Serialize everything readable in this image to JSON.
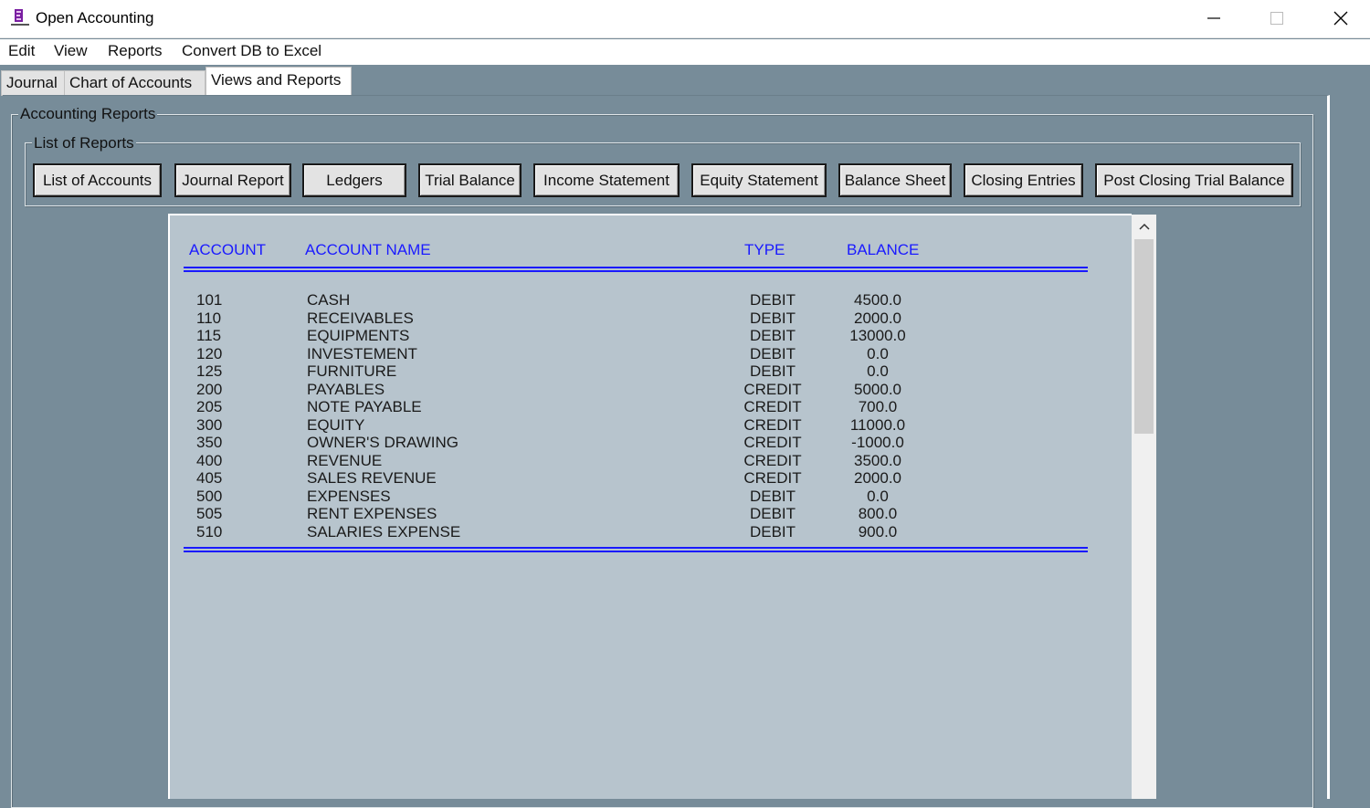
{
  "window": {
    "title": "Open Accounting"
  },
  "menu": {
    "items": [
      "Edit",
      "View",
      "Reports",
      "Convert DB to Excel"
    ]
  },
  "tabs": [
    {
      "label": "Journal",
      "active": false
    },
    {
      "label": "Chart of Accounts",
      "active": false
    },
    {
      "label": "Views and Reports",
      "active": true
    }
  ],
  "accounting_reports": {
    "title": "Accounting Reports",
    "list_title": "List of Reports",
    "buttons": [
      "List of Accounts",
      "Journal Report",
      "Ledgers",
      "Trial Balance",
      "Income Statement",
      "Equity Statement",
      "Balance Sheet",
      "Closing Entries",
      "Post Closing Trial Balance"
    ]
  },
  "report": {
    "headers": {
      "account": "ACCOUNT",
      "account_name": "ACCOUNT NAME",
      "type": "TYPE",
      "balance": "BALANCE"
    },
    "rows": [
      {
        "account": "101",
        "name": "CASH",
        "type": "DEBIT",
        "balance": "4500.0"
      },
      {
        "account": "110",
        "name": "RECEIVABLES",
        "type": "DEBIT",
        "balance": "2000.0"
      },
      {
        "account": "115",
        "name": "EQUIPMENTS",
        "type": "DEBIT",
        "balance": "13000.0"
      },
      {
        "account": "120",
        "name": "INVESTEMENT",
        "type": "DEBIT",
        "balance": "0.0"
      },
      {
        "account": "125",
        "name": "FURNITURE",
        "type": "DEBIT",
        "balance": "0.0"
      },
      {
        "account": "200",
        "name": "PAYABLES",
        "type": "CREDIT",
        "balance": "5000.0"
      },
      {
        "account": "205",
        "name": "NOTE PAYABLE",
        "type": "CREDIT",
        "balance": "700.0"
      },
      {
        "account": "300",
        "name": "EQUITY",
        "type": "CREDIT",
        "balance": "11000.0"
      },
      {
        "account": "350",
        "name": "OWNER'S DRAWING",
        "type": "CREDIT",
        "balance": "-1000.0"
      },
      {
        "account": "400",
        "name": "REVENUE",
        "type": "CREDIT",
        "balance": "3500.0"
      },
      {
        "account": "405",
        "name": "SALES REVENUE",
        "type": "CREDIT",
        "balance": "2000.0"
      },
      {
        "account": "500",
        "name": "EXPENSES",
        "type": "DEBIT",
        "balance": "0.0"
      },
      {
        "account": "505",
        "name": "RENT EXPENSES",
        "type": "DEBIT",
        "balance": "800.0"
      },
      {
        "account": "510",
        "name": "SALARIES EXPENSE",
        "type": "DEBIT",
        "balance": "900.0"
      }
    ]
  },
  "colors": {
    "background": "#778c99",
    "report_background": "#b7c4cd",
    "header_text": "#1a1aff",
    "rule_lines": "#1a1aff"
  },
  "icons": {
    "app": "app-logo-icon",
    "minimize": "minimize-icon",
    "maximize": "maximize-icon",
    "close": "close-icon",
    "scroll_up": "chevron-up-icon"
  }
}
